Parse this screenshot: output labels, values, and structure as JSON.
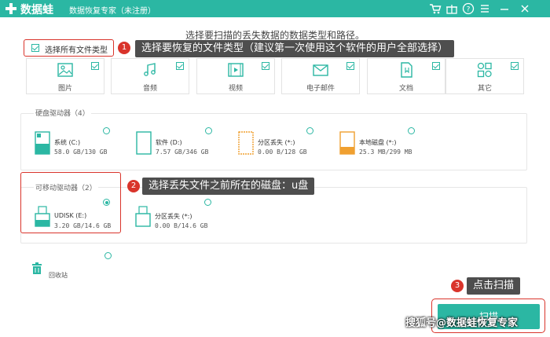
{
  "titlebar": {
    "app_name": "数据蛙",
    "app_subtitle": "数据恢复专家（未注册）",
    "icons": [
      "cart-icon",
      "gift-icon",
      "help-icon",
      "menu-icon",
      "minimize-icon",
      "close-icon"
    ],
    "bg_color": "#2bb7a3"
  },
  "headline": "选择要扫描的丢失数据的数据类型和路径。",
  "select_all": {
    "label": "选择所有文件类型",
    "checked": true
  },
  "annotations": [
    {
      "number": "1",
      "text": "选择要恢复的文件类型（建议第一次使用这个软件的用户全部选择）"
    },
    {
      "number": "2",
      "text": "选择丢失文件之前所在的磁盘：u盘"
    },
    {
      "number": "3",
      "text": "点击扫描"
    }
  ],
  "file_types": [
    {
      "label": "图片",
      "icon": "image-icon",
      "checked": true
    },
    {
      "label": "音频",
      "icon": "music-icon",
      "checked": true
    },
    {
      "label": "视频",
      "icon": "video-icon",
      "checked": true
    },
    {
      "label": "电子邮件",
      "icon": "email-icon",
      "checked": true
    },
    {
      "label": "文档",
      "icon": "document-icon",
      "checked": true
    },
    {
      "label": "其它",
      "icon": "other-icon",
      "checked": true
    }
  ],
  "hard_drives": {
    "title": "硬盘驱动器（4）",
    "items": [
      {
        "name": "系统 (C:)",
        "size": "58.0 GB/130 GB",
        "selected": false
      },
      {
        "name": "软件 (D:)",
        "size": "7.57 GB/346 GB",
        "selected": false
      },
      {
        "name": "分区丢失 (*:)",
        "size": "0.00  B/128 GB",
        "selected": false
      },
      {
        "name": "本地磁盘 (*:)",
        "size": "25.3 MB/299 MB",
        "selected": false
      }
    ]
  },
  "removable_drives": {
    "title": "可移动驱动器（2）",
    "items": [
      {
        "name": "UDISK (E:)",
        "size": "3.20 GB/14.6 GB",
        "selected": true
      },
      {
        "name": "分区丢失 (*:)",
        "size": "0.00  B/14.6 GB",
        "selected": false
      }
    ]
  },
  "recycle_bin": {
    "label": "回收站",
    "selected": false
  },
  "scan_button_label": "扫描",
  "watermark": "搜狐号@数据蛙恢复专家",
  "colors": {
    "accent": "#2bb7a3",
    "highlight": "#d9342b",
    "callout_bg": "#4e4e4e"
  }
}
